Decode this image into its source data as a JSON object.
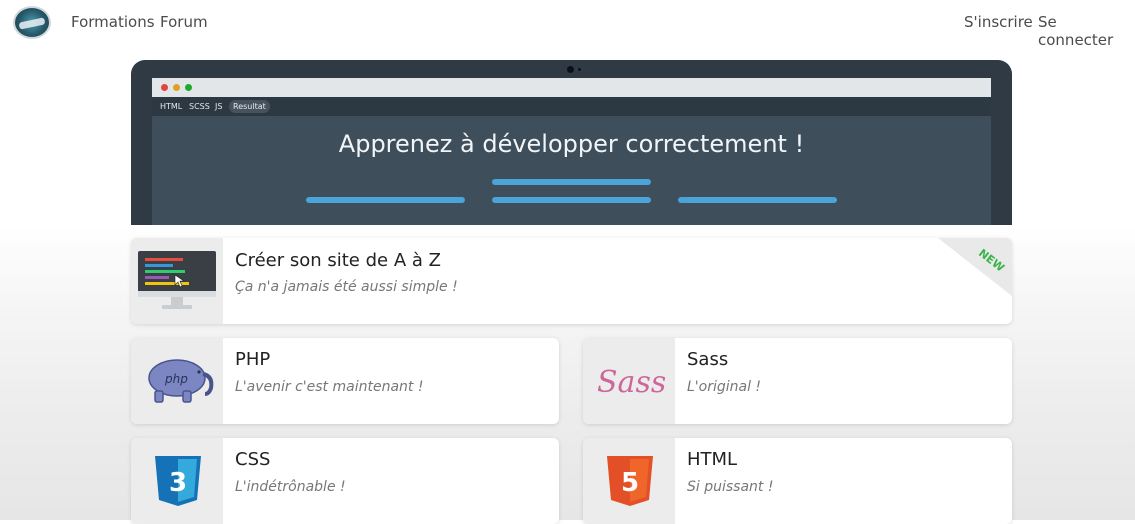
{
  "nav": {
    "logo": "logo-icon",
    "left_links": [
      "Formations",
      "Forum"
    ],
    "right_links": [
      "S'inscrire",
      "Se connecter"
    ]
  },
  "hero": {
    "tabs": [
      "HTML",
      "SCSS",
      "JS",
      "Resultat"
    ],
    "active_tab": "Resultat",
    "headline": "Apprenez à développer correctement !",
    "traffic_lights": [
      "#e0443e",
      "#dea123",
      "#1aab29"
    ],
    "accent": "#4aa3d9"
  },
  "featured": {
    "title": "Créer son site de A à Z",
    "subtitle": "Ça n'a jamais été aussi simple !",
    "badge": "NEW",
    "icon": "monitor-code-icon"
  },
  "courses": [
    {
      "title": "PHP",
      "subtitle": "L'avenir c'est maintenant !",
      "icon": "php-elephant-icon"
    },
    {
      "title": "Sass",
      "subtitle": "L'original !",
      "icon": "sass-logo-icon"
    },
    {
      "title": "CSS",
      "subtitle": "L'indétrônable !",
      "icon": "css3-logo-icon"
    },
    {
      "title": "HTML",
      "subtitle": "Si puissant !",
      "icon": "html5-logo-icon"
    }
  ]
}
